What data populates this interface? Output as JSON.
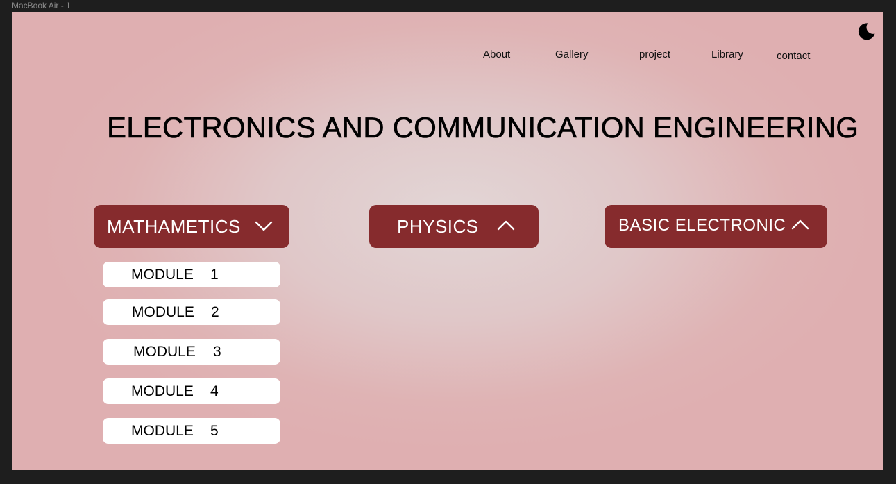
{
  "frame_label": "MacBook Air - 1",
  "theme_toggle": {
    "icon": "moon-icon"
  },
  "nav": {
    "items": [
      {
        "label": "About"
      },
      {
        "label": "Gallery"
      },
      {
        "label": "project"
      },
      {
        "label": "Library"
      },
      {
        "label": "contact"
      }
    ]
  },
  "page_title": "ELECTRONICS AND COMMUNICATION ENGINEERING",
  "subjects": [
    {
      "label": "MATHAMETICS",
      "chevron": "chevron-down-icon",
      "expanded": true
    },
    {
      "label": "PHYSICS",
      "chevron": "chevron-up-icon",
      "expanded": false
    },
    {
      "label": "BASIC ELECTRONIC",
      "chevron": "chevron-up-icon",
      "expanded": false
    }
  ],
  "modules": [
    {
      "label": "MODULE",
      "number": "1"
    },
    {
      "label": "MODULE",
      "number": "2"
    },
    {
      "label": "MODULE",
      "number": "3"
    },
    {
      "label": "MODULE",
      "number": "4"
    },
    {
      "label": "MODULE",
      "number": "5"
    }
  ],
  "colors": {
    "subject_button": "#862b2d",
    "module_background": "#ffffff",
    "page_background": "#dfb3b4"
  }
}
